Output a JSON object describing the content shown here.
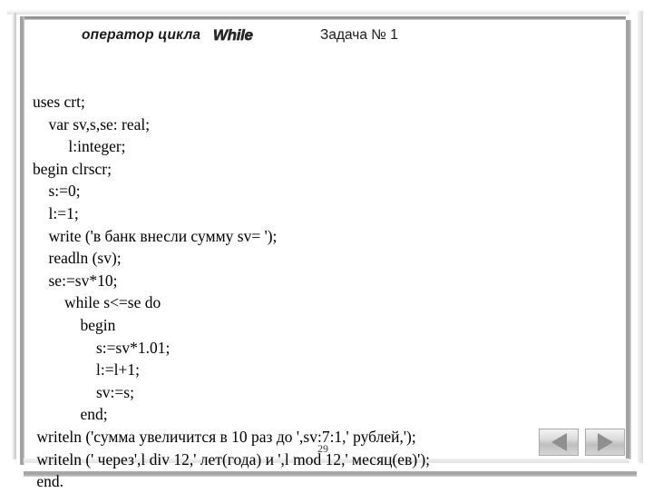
{
  "slide": {
    "title": {
      "phrase": "оператор цикла",
      "keyword": "While",
      "task": "Задача № 1"
    },
    "page_number": "29",
    "code_lines": [
      "uses crt;",
      "    var sv,s,se: real;",
      "         l:integer;",
      "begin clrscr;",
      "    s:=0;",
      "    l:=1;",
      "    write ('в банк внесли сумму sv= ');",
      "    readln (sv);",
      "    se:=sv*10;",
      "        while s<=se do",
      "            begin",
      "                s:=sv*1.01;",
      "                l:=l+1;",
      "                sv:=s;",
      "            end;",
      " writeln ('сумма увеличится в 10 раз до ',sv:7:1,' рублей,');",
      " writeln (' через',l div 12,' лет(года) и ',l mod 12,' месяц(ев)');",
      " end."
    ],
    "nav": {
      "prev_label": "Previous slide",
      "next_label": "Next slide"
    },
    "colors": {
      "text": "#000000",
      "frame": "#9c9c9c",
      "button_arrow": "#8f8f8f",
      "background": "#ffffff"
    }
  }
}
